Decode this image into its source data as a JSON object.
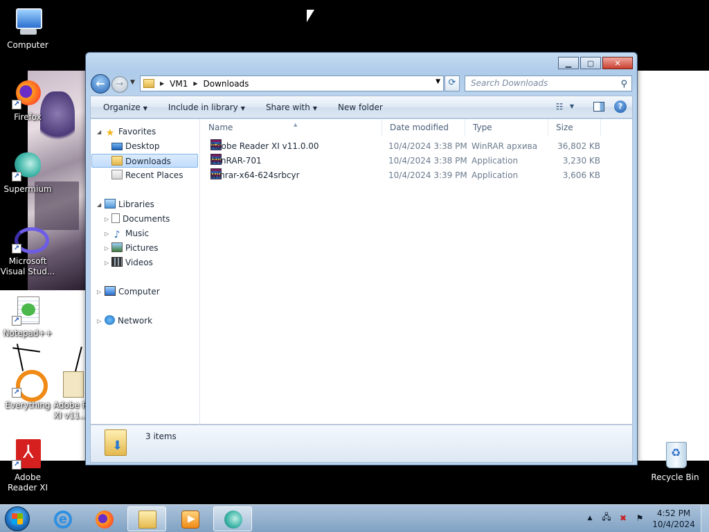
{
  "desktop": {
    "icons": [
      {
        "label": "Computer"
      },
      {
        "label": "Firefox"
      },
      {
        "label": "Supermium"
      },
      {
        "label": "Microsoft Visual Stud..."
      },
      {
        "label": "Notepad++"
      },
      {
        "label": "Everything"
      },
      {
        "label": "Adobe R XI v11..."
      },
      {
        "label": "Adobe Reader XI"
      },
      {
        "label": "Recycle Bin"
      }
    ]
  },
  "window": {
    "address": {
      "crumbs": [
        "VM1",
        "Downloads"
      ]
    },
    "search": {
      "placeholder": "Search Downloads"
    },
    "toolbar": {
      "organize": "Organize",
      "include_in_library": "Include in library",
      "share_with": "Share with",
      "new_folder": "New folder"
    },
    "nav": {
      "favorites": "Favorites",
      "desktop": "Desktop",
      "downloads": "Downloads",
      "recent_places": "Recent Places",
      "libraries": "Libraries",
      "documents": "Documents",
      "music": "Music",
      "pictures": "Pictures",
      "videos": "Videos",
      "computer": "Computer",
      "network": "Network"
    },
    "columns": {
      "name": "Name",
      "date_modified": "Date modified",
      "type": "Type",
      "size": "Size"
    },
    "files": [
      {
        "name": "Adobe Reader XI v11.0.00",
        "date": "10/4/2024 3:38 PM",
        "type": "WinRAR архива",
        "size": "36,802 KB"
      },
      {
        "name": "WinRAR-701",
        "date": "10/4/2024 3:38 PM",
        "type": "Application",
        "size": "3,230 KB"
      },
      {
        "name": "winrar-x64-624srbcyr",
        "date": "10/4/2024 3:39 PM",
        "type": "Application",
        "size": "3,606 KB"
      }
    ],
    "status": {
      "count": "3 items"
    }
  },
  "taskbar": {
    "clock": {
      "time": "4:52 PM",
      "date": "10/4/2024"
    }
  },
  "colors": {
    "accent": "#2b6fd0",
    "selection": "#c1dcfc",
    "taskbar": "#a7c2de"
  }
}
